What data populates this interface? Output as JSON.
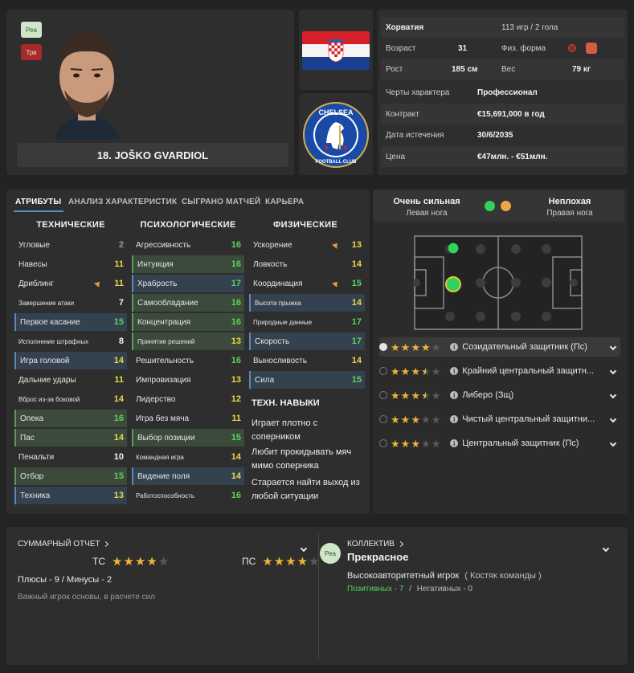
{
  "player": {
    "badge_top": "Реа",
    "badge_bottom": "Трв",
    "name": "18. JOŠKO GVARDIOL"
  },
  "info": {
    "nation": "Хорватия",
    "caps": "113 игр / 2 гола",
    "age_label": "Возраст",
    "age": "31",
    "fitness_label": "Физ. форма",
    "height_label": "Рост",
    "height": "185 см",
    "weight_label": "Вес",
    "weight": "79 кг",
    "personality_label": "Черты характера",
    "personality": "Профессионал",
    "contract_label": "Контракт",
    "contract": "€15,691,000 в год",
    "expiry_label": "Дата истечения",
    "expiry": "30/6/2035",
    "price_label": "Цена",
    "price": "€47млн. - €51млн."
  },
  "tabs": [
    "АТРИБУТЫ",
    "АНАЛИЗ ХАРАКТЕРИСТИК",
    "СЫГРАНО МАТЧЕЙ",
    "КАРЬЕРА"
  ],
  "columns": {
    "technical": "ТЕХНИЧЕСКИЕ",
    "mental": "ПСИХОЛОГИЧЕСКИЕ",
    "physical": "ФИЗИЧЕСКИЕ"
  },
  "technical": [
    {
      "name": "Угловые",
      "value": "2"
    },
    {
      "name": "Навесы",
      "value": "11"
    },
    {
      "name": "Дриблинг",
      "value": "11"
    },
    {
      "name": "Завершение атаки",
      "value": "7"
    },
    {
      "name": "Первое касание",
      "value": "15"
    },
    {
      "name": "Исполнение штрафных",
      "value": "8"
    },
    {
      "name": "Игра головой",
      "value": "14"
    },
    {
      "name": "Дальние удары",
      "value": "11"
    },
    {
      "name": "Вброс из-за боковой",
      "value": "14"
    },
    {
      "name": "Опека",
      "value": "16"
    },
    {
      "name": "Пас",
      "value": "14"
    },
    {
      "name": "Пенальти",
      "value": "10"
    },
    {
      "name": "Отбор",
      "value": "15"
    },
    {
      "name": "Техника",
      "value": "13"
    }
  ],
  "mental": [
    {
      "name": "Агрессивность",
      "value": "16"
    },
    {
      "name": "Интуиция",
      "value": "16"
    },
    {
      "name": "Храбрость",
      "value": "17"
    },
    {
      "name": "Самообладание",
      "value": "16"
    },
    {
      "name": "Концентрация",
      "value": "16"
    },
    {
      "name": "Принятие решений",
      "value": "13"
    },
    {
      "name": "Решительность",
      "value": "16"
    },
    {
      "name": "Импровизация",
      "value": "13"
    },
    {
      "name": "Лидерство",
      "value": "12"
    },
    {
      "name": "Игра без мяча",
      "value": "11"
    },
    {
      "name": "Выбор позиции",
      "value": "15"
    },
    {
      "name": "Командная игра",
      "value": "14"
    },
    {
      "name": "Видение поля",
      "value": "14"
    },
    {
      "name": "Работоспособность",
      "value": "16"
    }
  ],
  "physical": [
    {
      "name": "Ускорение",
      "value": "13"
    },
    {
      "name": "Ловкость",
      "value": "14"
    },
    {
      "name": "Координация",
      "value": "15"
    },
    {
      "name": "Высота прыжка",
      "value": "14"
    },
    {
      "name": "Природные данные",
      "value": "17"
    },
    {
      "name": "Скорость",
      "value": "17"
    },
    {
      "name": "Выносливость",
      "value": "14"
    },
    {
      "name": "Сила",
      "value": "15"
    }
  ],
  "traits": {
    "title": "ТЕХН. НАВЫКИ",
    "items": [
      "Играет плотно с соперником",
      "Любит прокидывать мяч мимо соперника",
      "Старается найти выход из любой ситуации"
    ]
  },
  "feet": {
    "left_title": "Очень сильная",
    "left_sub": "Левая нога",
    "right_title": "Неплохая",
    "right_sub": "Правая нога",
    "left_color": "#2fd25a",
    "right_color": "#e8a84a"
  },
  "roles": [
    {
      "label": "Созидательный защитник (Пс)",
      "stars": 4
    },
    {
      "label": "Крайний центральный защитн...",
      "stars": 3.5
    },
    {
      "label": "Либеро (Зщ)",
      "stars": 3.5
    },
    {
      "label": "Чистый центральный защитни...",
      "stars": 3
    },
    {
      "label": "Центральный защитник (Пс)",
      "stars": 3
    }
  ],
  "report": {
    "title": "СУММАРНЫЙ ОТЧЕТ",
    "ts_label": "ТС",
    "ts_stars": 4,
    "ps_label": "ПС",
    "ps_stars": 4,
    "plus_minus": "Плюсы - 9 / Минусы - 2",
    "note": "Важный игрок основы, в расчете сил"
  },
  "team": {
    "title": "КОЛЛЕКТИВ",
    "badge": "Реа",
    "rating": "Прекрасное",
    "status": "Высокоавторитетный игрок",
    "group": "( Костяк команды )",
    "positive": "Позитивных - 7",
    "separator": "/",
    "negative": "Негативных - 0"
  }
}
